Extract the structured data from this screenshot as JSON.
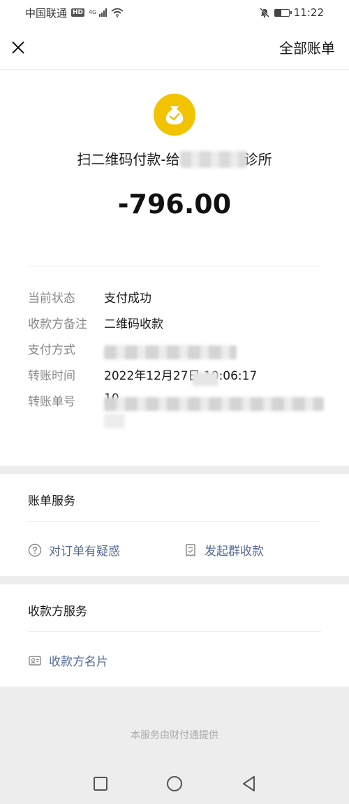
{
  "status_bar": {
    "carrier": "中国联通",
    "hd": "HD",
    "network": "4G",
    "time": "11:22"
  },
  "header": {
    "close_icon": "close-icon",
    "all_bills_label": "全部账单"
  },
  "transaction": {
    "merchant_name_prefix": "扫二维码付款-给",
    "merchant_name_suffix": "诊所",
    "amount": "-796.00",
    "icon": "money-bag-check-icon",
    "icon_color": "#f2c300"
  },
  "details": {
    "status_label": "当前状态",
    "status_value": "支付成功",
    "remark_label": "收款方备注",
    "remark_value": "二维码收款",
    "payment_method_label": "支付方式",
    "transfer_time_label": "转账时间",
    "transfer_time_value": "2022年12月27日 10:06:17",
    "transfer_no_label": "转账单号",
    "transfer_no_prefix": "10"
  },
  "bill_service": {
    "title": "账单服务",
    "doubt_label": "对订单有疑惑",
    "doubt_icon": "question-circle-icon",
    "group_collect_label": "发起群收款",
    "group_collect_icon": "bill-check-icon"
  },
  "payee_service": {
    "title": "收款方服务",
    "business_card_label": "收款方名片",
    "business_card_icon": "contact-card-icon"
  },
  "footer": {
    "note": "本服务由财付通提供"
  },
  "colors": {
    "link": "#576b95",
    "label": "#888888",
    "background": "#ededed"
  }
}
